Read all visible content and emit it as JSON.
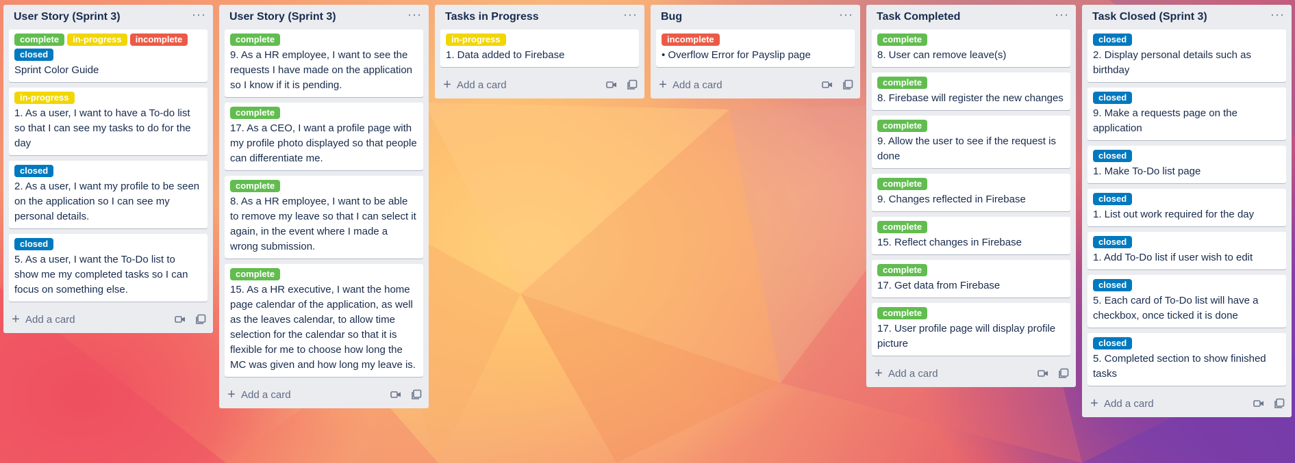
{
  "board": {
    "lists": [
      {
        "title": "User Story (Sprint 3)",
        "cards": [
          {
            "labels": [
              {
                "text": "complete",
                "kind": "complete"
              },
              {
                "text": "in-progress",
                "kind": "in-progress"
              },
              {
                "text": "incomplete",
                "kind": "incomplete"
              },
              {
                "text": "closed",
                "kind": "closed"
              }
            ],
            "text": "Sprint Color Guide"
          },
          {
            "labels": [
              {
                "text": "in-progress",
                "kind": "in-progress"
              }
            ],
            "text": "1. As a user, I want to have a To-do list so that I can see my tasks to do for the day"
          },
          {
            "labels": [
              {
                "text": "closed",
                "kind": "closed"
              }
            ],
            "text": "2. As a user, I want my profile to be seen on the application so I can see my personal details."
          },
          {
            "labels": [
              {
                "text": "closed",
                "kind": "closed"
              }
            ],
            "text": "5. As a user, I want the To-Do list to show me my completed tasks so I can focus on something else."
          }
        ],
        "add_card_label": "Add a card"
      },
      {
        "title": "User Story (Sprint 3)",
        "cards": [
          {
            "labels": [
              {
                "text": "complete",
                "kind": "complete"
              }
            ],
            "text": "9. As a HR employee, I want to see the requests I have made on the application so I know if it is pending."
          },
          {
            "labels": [
              {
                "text": "complete",
                "kind": "complete"
              }
            ],
            "text": "17. As a CEO, I want a profile page with my profile photo displayed so that people can differentiate me."
          },
          {
            "labels": [
              {
                "text": "complete",
                "kind": "complete"
              }
            ],
            "text": "8. As a HR employee, I want to be able to remove my leave so that I can select it again, in the event where I made a wrong submission."
          },
          {
            "labels": [
              {
                "text": "complete",
                "kind": "complete"
              }
            ],
            "text": "15. As a HR executive, I want the home page calendar of the application, as well as the leaves calendar, to allow time selection for the calendar so that it is flexible for me to choose how long the MC was given and how long my leave is."
          }
        ],
        "add_card_label": "Add a card"
      },
      {
        "title": "Tasks in Progress",
        "cards": [
          {
            "labels": [
              {
                "text": "in-progress",
                "kind": "in-progress"
              }
            ],
            "text": "1. Data added to Firebase"
          }
        ],
        "add_card_label": "Add a card"
      },
      {
        "title": "Bug",
        "cards": [
          {
            "labels": [
              {
                "text": "incomplete",
                "kind": "incomplete"
              }
            ],
            "text": "• Overflow Error for Payslip page"
          }
        ],
        "add_card_label": "Add a card"
      },
      {
        "title": "Task Completed",
        "cards": [
          {
            "labels": [
              {
                "text": "complete",
                "kind": "complete"
              }
            ],
            "text": "8. User can remove leave(s)"
          },
          {
            "labels": [
              {
                "text": "complete",
                "kind": "complete"
              }
            ],
            "text": "8. Firebase will register the new changes"
          },
          {
            "labels": [
              {
                "text": "complete",
                "kind": "complete"
              }
            ],
            "text": "9. Allow the user to see if the request is done"
          },
          {
            "labels": [
              {
                "text": "complete",
                "kind": "complete"
              }
            ],
            "text": "9. Changes reflected in Firebase"
          },
          {
            "labels": [
              {
                "text": "complete",
                "kind": "complete"
              }
            ],
            "text": "15. Reflect changes in Firebase"
          },
          {
            "labels": [
              {
                "text": "complete",
                "kind": "complete"
              }
            ],
            "text": "17. Get data from Firebase"
          },
          {
            "labels": [
              {
                "text": "complete",
                "kind": "complete"
              }
            ],
            "text": "17. User profile page will display profile picture"
          }
        ],
        "add_card_label": "Add a card"
      },
      {
        "title": "Task Closed (Sprint 3)",
        "cards": [
          {
            "labels": [
              {
                "text": "closed",
                "kind": "closed"
              }
            ],
            "text": "2. Display personal details such as birthday"
          },
          {
            "labels": [
              {
                "text": "closed",
                "kind": "closed"
              }
            ],
            "text": "9. Make a requests page on the application"
          },
          {
            "labels": [
              {
                "text": "closed",
                "kind": "closed"
              }
            ],
            "text": "1. Make To-Do list page"
          },
          {
            "labels": [
              {
                "text": "closed",
                "kind": "closed"
              }
            ],
            "text": "1. List out work required for the day"
          },
          {
            "labels": [
              {
                "text": "closed",
                "kind": "closed"
              }
            ],
            "text": "1. Add To-Do list if user wish to edit"
          },
          {
            "labels": [
              {
                "text": "closed",
                "kind": "closed"
              }
            ],
            "text": "5. Each card of To-Do list will have a checkbox, once ticked it is done"
          },
          {
            "labels": [
              {
                "text": "closed",
                "kind": "closed"
              }
            ],
            "text": "5. Completed section to show finished tasks"
          }
        ],
        "add_card_label": "Add a card"
      }
    ]
  },
  "icons": {
    "list_menu": "ellipsis-icon",
    "add": "plus-icon",
    "footer_left": "video-icon",
    "footer_right": "template-icon"
  },
  "colors": {
    "complete": "#61bd4f",
    "in-progress": "#f2d600",
    "incomplete": "#eb5a46",
    "closed": "#0079bf",
    "list_bg": "#ebecf0"
  }
}
